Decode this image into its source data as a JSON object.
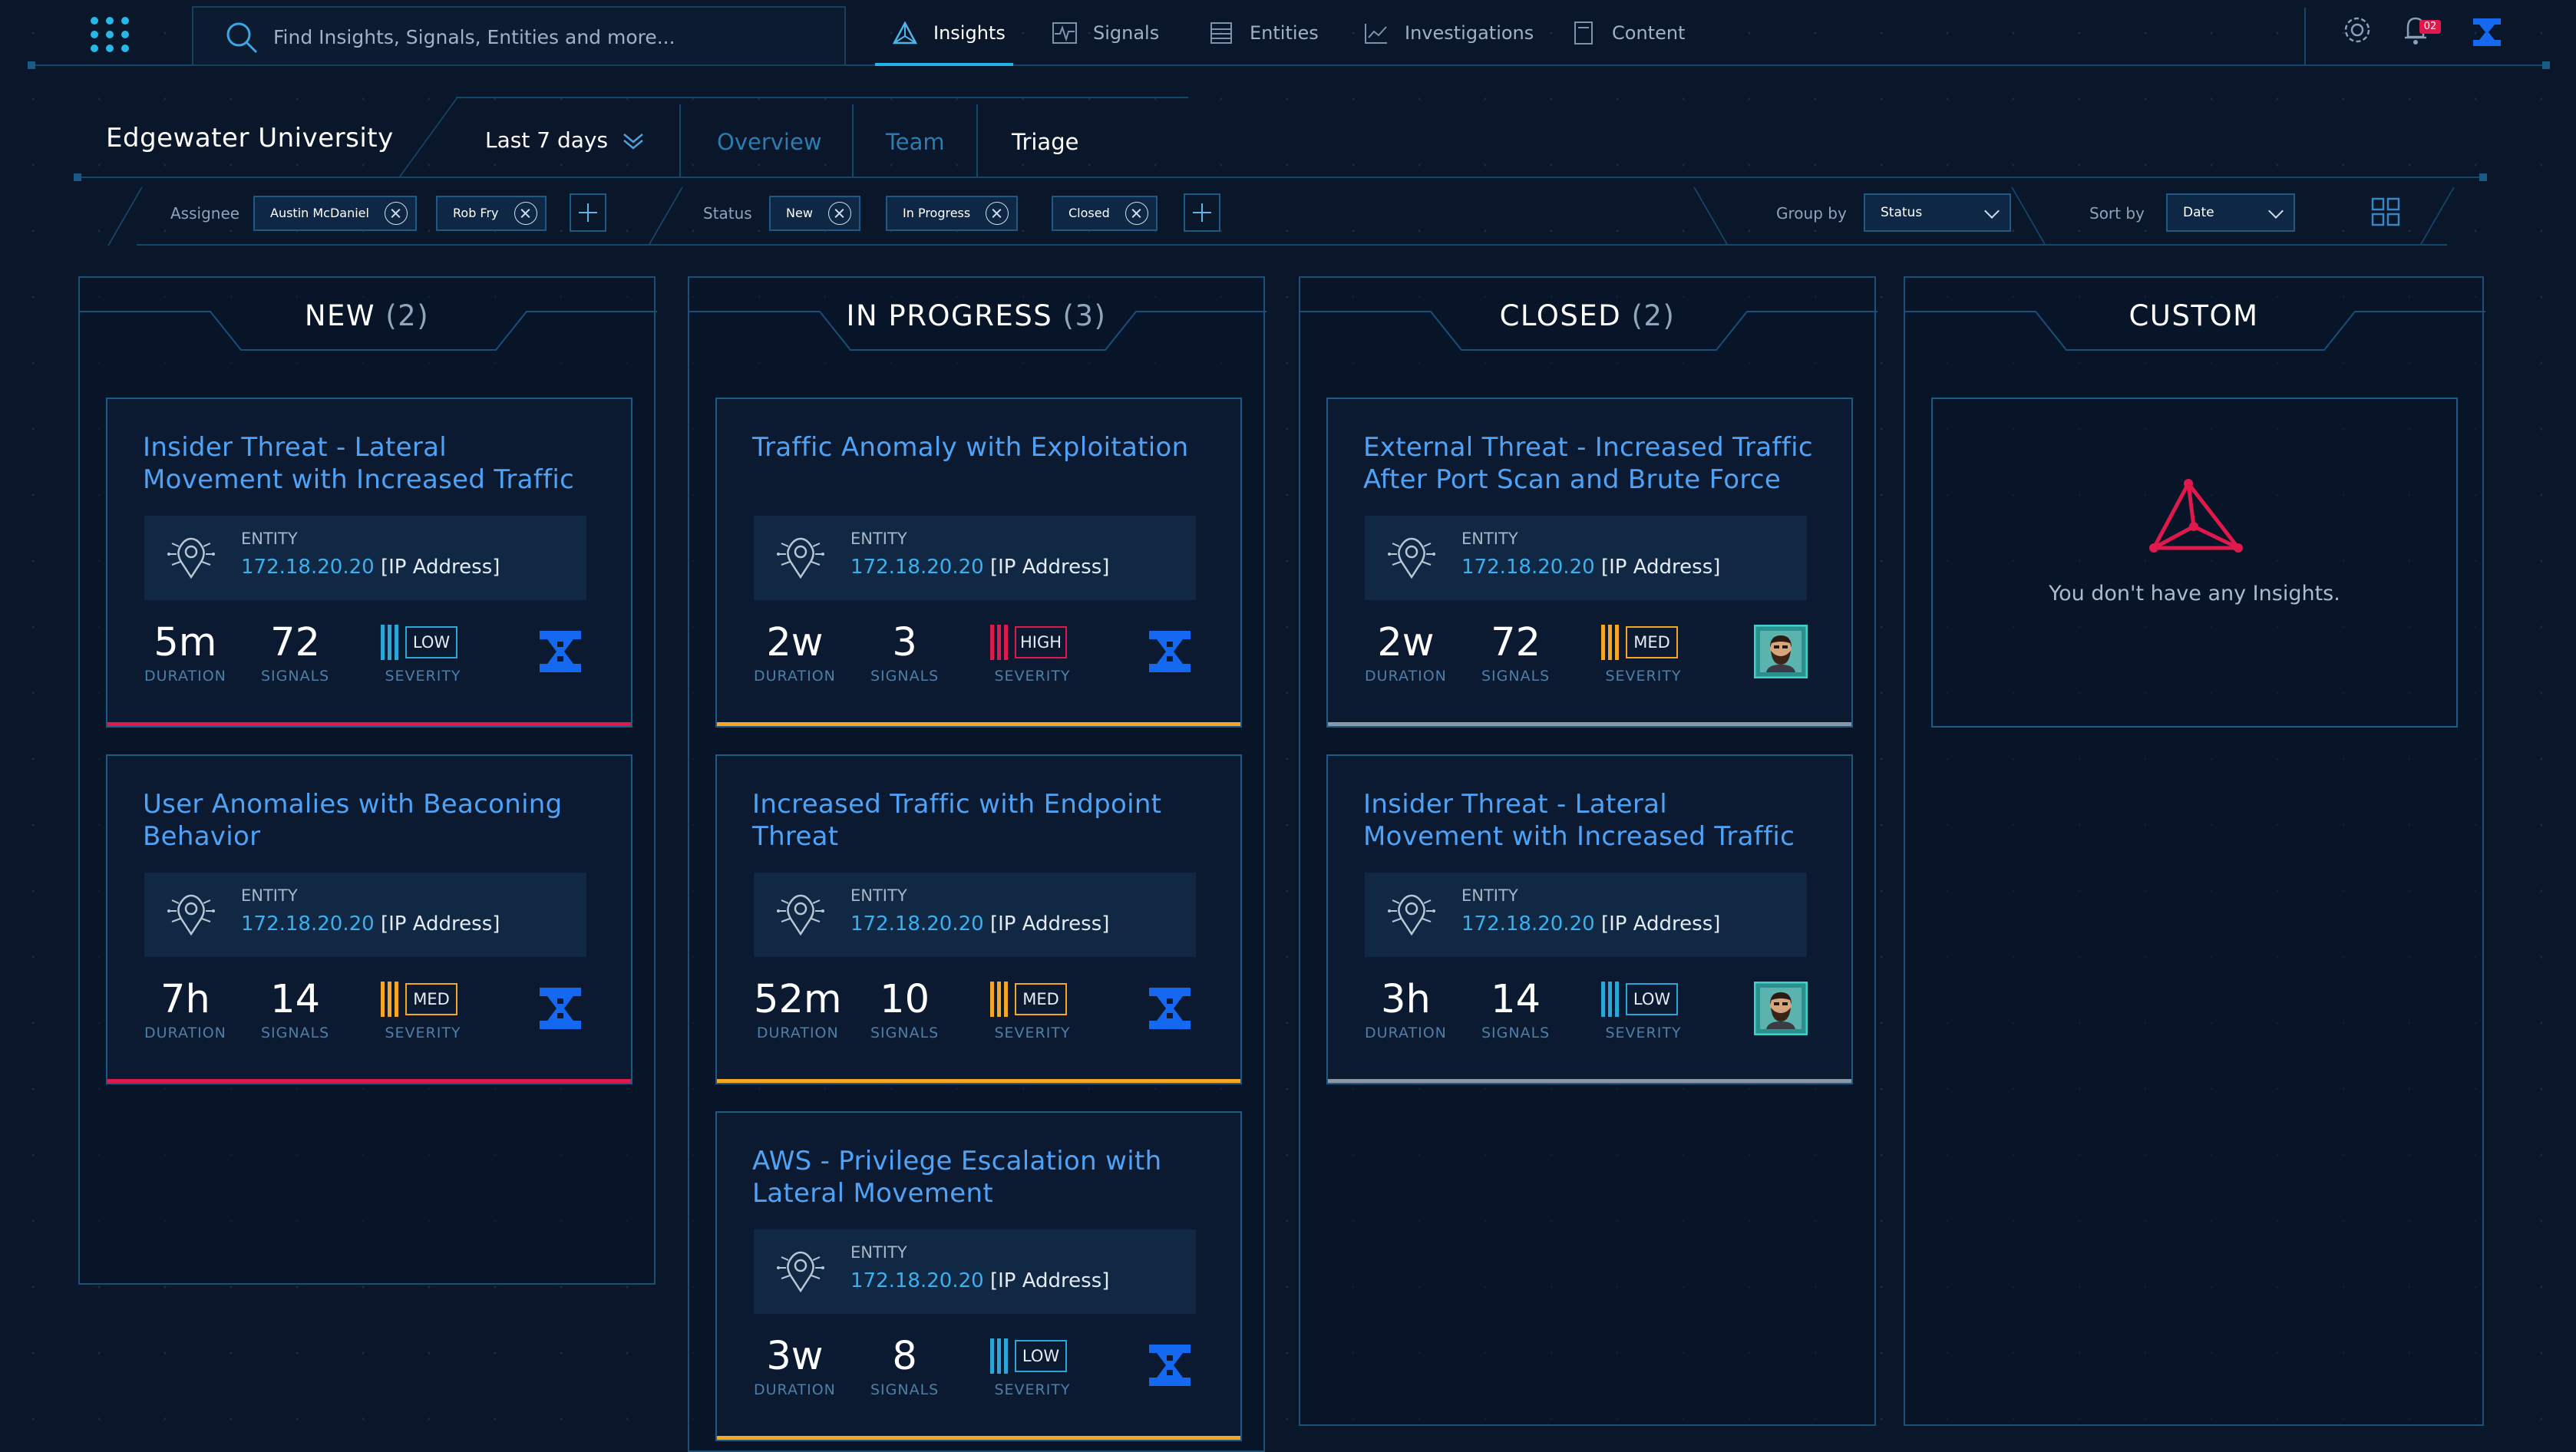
{
  "nav": {
    "search_placeholder": "Find Insights, Signals, Entities and more...",
    "tabs": [
      {
        "label": "Insights",
        "icon": "insights-icon",
        "active": true
      },
      {
        "label": "Signals",
        "icon": "signals-icon",
        "active": false
      },
      {
        "label": "Entities",
        "icon": "entities-icon",
        "active": false
      },
      {
        "label": "Investigations",
        "icon": "investigations-icon",
        "active": false
      },
      {
        "label": "Content",
        "icon": "content-icon",
        "active": false
      }
    ],
    "notification_count": "02"
  },
  "header": {
    "org": "Edgewater University",
    "range": "Last 7 days",
    "tabs": [
      "Overview",
      "Team",
      "Triage"
    ],
    "active_tab": "Triage"
  },
  "filters": {
    "assignee_label": "Assignee",
    "assignees": [
      "Austin McDaniel",
      "Rob Fry"
    ],
    "status_label": "Status",
    "statuses": [
      "New",
      "In Progress",
      "Closed"
    ],
    "group_label": "Group by",
    "group_value": "Status",
    "sort_label": "Sort by",
    "sort_value": "Date"
  },
  "labels": {
    "entity": "ENTITY",
    "duration": "DURATION",
    "signals": "SIGNALS",
    "severity": "SEVERITY"
  },
  "colors": {
    "accent": "#22b2ea",
    "title_blue": "#4fa2f5",
    "high": "#e0194d",
    "med": "#f5a623",
    "low": "#2aa6d8",
    "closed": "#8b97a5"
  },
  "columns": [
    {
      "title": "NEW",
      "count": "(2)",
      "cards": [
        {
          "title": "Insider Threat - Lateral Movement with Increased Traffic",
          "ip": "172.18.20.20",
          "type": "[IP Address]",
          "duration": "5m",
          "signals": "72",
          "severity": "LOW",
          "underline": "high",
          "owner": "logo-icon"
        },
        {
          "title": "User Anomalies with Beaconing Behavior",
          "ip": "172.18.20.20",
          "type": "[IP Address]",
          "duration": "7h",
          "signals": "14",
          "severity": "MED",
          "underline": "high",
          "owner": "logo-icon"
        }
      ]
    },
    {
      "title": "IN PROGRESS",
      "count": "(3)",
      "cards": [
        {
          "title": "Traffic Anomaly with Exploitation",
          "ip": "172.18.20.20",
          "type": "[IP Address]",
          "duration": "2w",
          "signals": "3",
          "severity": "HIGH",
          "underline": "med",
          "owner": "logo-icon"
        },
        {
          "title": "Increased Traffic with Endpoint Threat",
          "ip": "172.18.20.20",
          "type": "[IP Address]",
          "duration": "52m",
          "signals": "10",
          "severity": "MED",
          "underline": "med",
          "owner": "logo-icon"
        },
        {
          "title": "AWS - Privilege Escalation with Lateral Movement",
          "ip": "172.18.20.20",
          "type": "[IP Address]",
          "duration": "3w",
          "signals": "8",
          "severity": "LOW",
          "underline": "med",
          "owner": "logo-icon"
        }
      ]
    },
    {
      "title": "CLOSED",
      "count": "(2)",
      "cards": [
        {
          "title": "External Threat - Increased Traffic After Port Scan and Brute Force",
          "ip": "172.18.20.20",
          "type": "[IP Address]",
          "duration": "2w",
          "signals": "72",
          "severity": "MED",
          "underline": "closed",
          "owner": "avatar"
        },
        {
          "title": "Insider Threat - Lateral Movement with Increased Traffic",
          "ip": "172.18.20.20",
          "type": "[IP Address]",
          "duration": "3h",
          "signals": "14",
          "severity": "LOW",
          "underline": "closed",
          "owner": "avatar"
        }
      ]
    },
    {
      "title": "CUSTOM",
      "count": "",
      "empty_text": "You don't have any Insights.",
      "cards": []
    }
  ]
}
